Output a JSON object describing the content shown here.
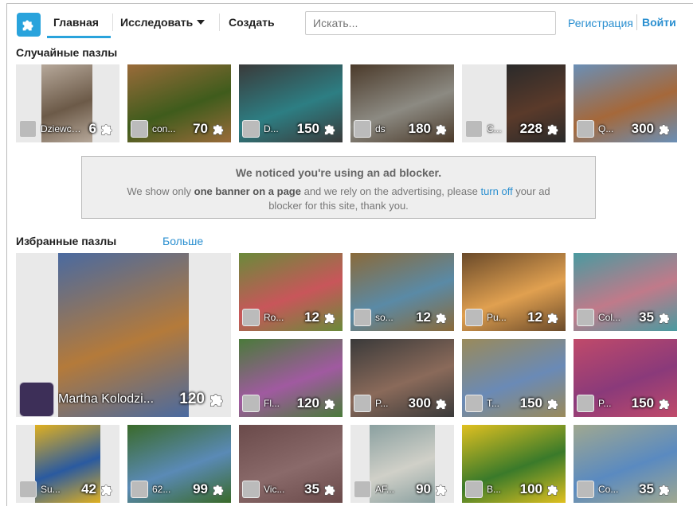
{
  "nav": {
    "home": "Главная",
    "explore": "Исследовать",
    "create": "Создать",
    "search_placeholder": "Искать...",
    "register": "Регистрация",
    "login": "Войти"
  },
  "random": {
    "title": "Случайные пазлы",
    "items": [
      {
        "name": "Dziewczy...",
        "count": "6",
        "img": "#6c5a48",
        "img2": "#b6a89a"
      },
      {
        "name": "con...",
        "count": "70",
        "img": "#3f5c1c",
        "img2": "#9a6b3a"
      },
      {
        "name": "D...",
        "count": "150",
        "img": "#2d7e83",
        "img2": "#3a3a3a"
      },
      {
        "name": "ds",
        "count": "180",
        "img": "#8c8a82",
        "img2": "#4b3a2a"
      },
      {
        "name": "C...",
        "count": "228",
        "img": "#5a3a2a",
        "img2": "#2a2a2a"
      },
      {
        "name": "Q...",
        "count": "300",
        "img": "#a5683a",
        "img2": "#6a8fb6"
      }
    ]
  },
  "ad": {
    "title": "We noticed you're using an ad blocker.",
    "line1_a": "We show only ",
    "line1_b": "one banner on a page",
    "line1_c": " and we rely on the advertising, please ",
    "line1_link": "turn off",
    "line1_d": " your ad",
    "line2": "blocker for this site, thank you."
  },
  "featured": {
    "title": "Избранные пазлы",
    "more": "Больше",
    "big": {
      "name": "Martha Kolodzi...",
      "count": "120",
      "img": "#b47a3a",
      "img2": "#4a6aa0"
    },
    "row1": [
      {
        "name": "Ro...",
        "count": "12",
        "img": "#c8565a",
        "img2": "#6a8a3a"
      },
      {
        "name": "so...",
        "count": "12",
        "img": "#5a8aa6",
        "img2": "#8a6a3a"
      },
      {
        "name": "Pu...",
        "count": "12",
        "img": "#e0a050",
        "img2": "#6a4a2a"
      },
      {
        "name": "Col...",
        "count": "35",
        "img": "#c07a8a",
        "img2": "#4a9aa0"
      }
    ],
    "row2": [
      {
        "name": "Fl...",
        "count": "120",
        "img": "#a05aa0",
        "img2": "#4a7a3a"
      },
      {
        "name": "P...",
        "count": "300",
        "img": "#8a6a5a",
        "img2": "#3a3a3a"
      },
      {
        "name": "T...",
        "count": "150",
        "img": "#6a8ab6",
        "img2": "#9a8a5a"
      },
      {
        "name": "P...",
        "count": "150",
        "img": "#8a3a7a",
        "img2": "#c04a6a"
      }
    ],
    "row3": [
      {
        "name": "Su...",
        "count": "42",
        "img": "#2a5aa0",
        "img2": "#e0b020"
      },
      {
        "name": "62...",
        "count": "99",
        "img": "#5a8ab6",
        "img2": "#3a6a2a"
      },
      {
        "name": "Vic...",
        "count": "35",
        "img": "#8a6a6a",
        "img2": "#6a4a4a"
      },
      {
        "name": "AF...",
        "count": "90",
        "img": "#d0d0c8",
        "img2": "#8aa0a0"
      },
      {
        "name": "B...",
        "count": "100",
        "img": "#3a7a2a",
        "img2": "#e0c020"
      },
      {
        "name": "Co...",
        "count": "35",
        "img": "#5a8ac0",
        "img2": "#a0a890"
      }
    ]
  }
}
